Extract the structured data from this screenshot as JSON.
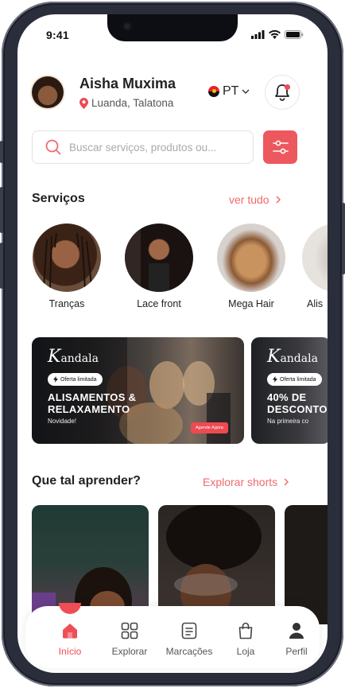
{
  "status_bar": {
    "time": "9:41"
  },
  "user": {
    "name": "Aisha Muxima",
    "location": "Luanda, Talatona"
  },
  "language": {
    "code": "PT"
  },
  "search": {
    "placeholder": "Buscar serviços, produtos ou..."
  },
  "services": {
    "title": "Serviços",
    "see_all": "ver tudo",
    "items": [
      {
        "label": "Tranças"
      },
      {
        "label": "Lace front"
      },
      {
        "label": "Mega Hair"
      },
      {
        "label": "Alis"
      }
    ]
  },
  "banners": [
    {
      "brand_initial": "K",
      "brand_rest": "andala",
      "chip": "Oferta limitada",
      "headline": "ALISAMENTOS &\nRELAXAMENTO",
      "subtitle": "Novidade!",
      "cta": "Agende Agora"
    },
    {
      "brand_initial": "K",
      "brand_rest": "andala",
      "chip": "Oferta limitada",
      "headline": "40% DE\nDESCONTO",
      "subtitle": "Na primeira co"
    }
  ],
  "learn": {
    "title": "Que tal aprender?",
    "link": "Explorar shorts"
  },
  "nav": [
    {
      "label": "Início",
      "icon": "home-icon",
      "active": true
    },
    {
      "label": "Explorar",
      "icon": "grid-icon"
    },
    {
      "label": "Marcações",
      "icon": "calendar-list-icon"
    },
    {
      "label": "Loja",
      "icon": "shopping-bag-icon"
    },
    {
      "label": "Perfil",
      "icon": "user-icon"
    }
  ],
  "colors": {
    "accent": "#ED585E",
    "link": "#EF6B6E"
  }
}
